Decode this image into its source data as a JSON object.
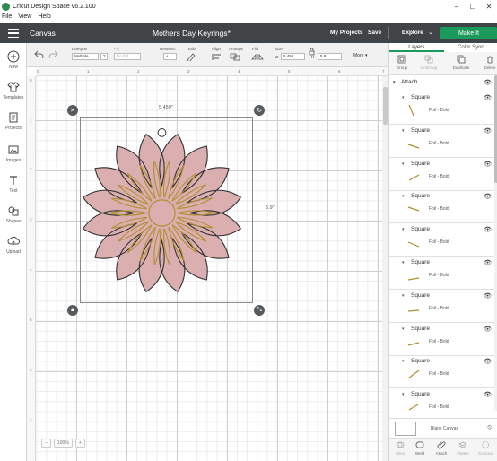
{
  "window": {
    "title": "Cricut Design Space  v6.2.100",
    "controls": [
      "–",
      "☐",
      "✕"
    ]
  },
  "menu": [
    "File",
    "View",
    "Help"
  ],
  "header": {
    "canvas_label": "Canvas",
    "project_title": "Mothers Day Keyrings*",
    "my_projects": "My Projects",
    "save": "Save",
    "explore": "Explore",
    "make_it": "Make It"
  },
  "left_rail": [
    {
      "label": "New",
      "icon": "plus-circle-icon"
    },
    {
      "label": "Templates",
      "icon": "shirt-icon"
    },
    {
      "label": "Projects",
      "icon": "projects-icon"
    },
    {
      "label": "Images",
      "icon": "images-icon"
    },
    {
      "label": "Text",
      "icon": "text-t-icon"
    },
    {
      "label": "Shapes",
      "icon": "shapes-icon"
    },
    {
      "label": "Upload",
      "icon": "upload-cloud-icon"
    }
  ],
  "toolbar": {
    "deselect": "Deselect",
    "linetype_label": "Linetype",
    "linetype_value": "Multiple",
    "fill_label": "Fill",
    "fill_value": "No Fill",
    "edit_label": "Edit",
    "align_label": "Align",
    "arrange_label": "Arrange",
    "flip_label": "Flip",
    "size_label": "Size",
    "width_prefix": "W",
    "width_value": "5.459",
    "height_prefix": "H",
    "height_value": "5.9",
    "more_label": "More"
  },
  "canvas": {
    "ruler_top": [
      "0",
      "1",
      "2",
      "3",
      "4",
      "5",
      "6",
      "7"
    ],
    "ruler_left": [
      "0",
      "1",
      "2",
      "3",
      "4",
      "5",
      "6",
      "7"
    ],
    "dim_width": "5.459\"",
    "dim_height": "5.9\"",
    "zoom": {
      "minus": "−",
      "value": "100%",
      "plus": "+"
    },
    "flower_colors": {
      "petal": "#dbaeb0",
      "outline": "#2f2f2f",
      "foil": "#b0902f",
      "hole": "#ffffff"
    }
  },
  "right_panel": {
    "tabs": [
      "Layers",
      "Color Sync"
    ],
    "actions": [
      "Group",
      "UnGroup",
      "Duplicate",
      "Delete"
    ],
    "group_name": "Attach",
    "layers": [
      {
        "name": "Square",
        "sub": "Foil - Bold"
      },
      {
        "name": "Square",
        "sub": "Foil - Bold"
      },
      {
        "name": "Square",
        "sub": "Foil - Bold"
      },
      {
        "name": "Square",
        "sub": "Foil - Bold"
      },
      {
        "name": "Square",
        "sub": "Foil - Bold"
      },
      {
        "name": "Square",
        "sub": "Foil - Bold"
      },
      {
        "name": "Square",
        "sub": "Foil - Bold"
      },
      {
        "name": "Square",
        "sub": "Foil - Bold"
      },
      {
        "name": "Square",
        "sub": "Foil - Bold"
      },
      {
        "name": "Square",
        "sub": "Foil - Bold"
      }
    ],
    "blank_canvas": "Blank Canvas",
    "bottom_actions": [
      "Slice",
      "Weld",
      "Attach",
      "Flatten",
      "Contour"
    ]
  }
}
